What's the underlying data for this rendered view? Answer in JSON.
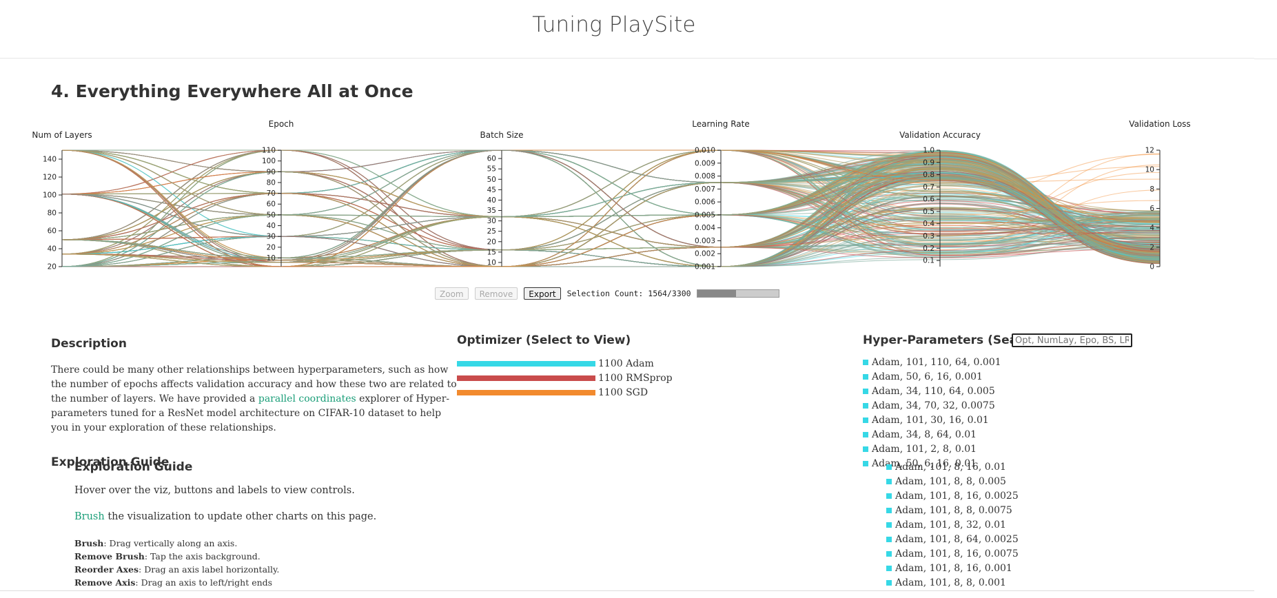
{
  "site_title": "Tuning PlaySite",
  "section_heading": "4. Everything Everywhere All at Once",
  "parallel_coords": {
    "axes": [
      {
        "label": "Num of Layers",
        "ticks": [
          "20",
          "40",
          "60",
          "80",
          "100",
          "120",
          "140"
        ],
        "domain": [
          20,
          150
        ]
      },
      {
        "label": "Epoch",
        "ticks": [
          "10",
          "20",
          "30",
          "40",
          "50",
          "60",
          "70",
          "80",
          "90",
          "100",
          "110"
        ],
        "domain": [
          2,
          110
        ]
      },
      {
        "label": "Batch Size",
        "ticks": [
          "10",
          "15",
          "20",
          "25",
          "30",
          "35",
          "40",
          "45",
          "50",
          "55",
          "60"
        ],
        "domain": [
          8,
          64
        ]
      },
      {
        "label": "Learning Rate",
        "ticks": [
          "0.001",
          "0.002",
          "0.003",
          "0.004",
          "0.005",
          "0.006",
          "0.007",
          "0.008",
          "0.009",
          "0.010"
        ],
        "domain": [
          0.001,
          0.01
        ]
      },
      {
        "label": "Validation Accuracy",
        "ticks": [
          "0.1",
          "0.2",
          "0.3",
          "0.4",
          "0.5",
          "0.6",
          "0.7",
          "0.8",
          "0.9",
          "1.0"
        ],
        "domain": [
          0.05,
          1.0
        ]
      },
      {
        "label": "Validation Loss",
        "ticks": [
          "0",
          "2",
          "4",
          "6",
          "8",
          "10",
          "12"
        ],
        "domain": [
          0,
          12
        ]
      }
    ],
    "colors": {
      "adam": "#36d8e6",
      "rmsprop": "#c94c4c",
      "sgd": "#f28a2e",
      "neutral": "#7aa89a",
      "tan": "#b59a5a"
    }
  },
  "controls": {
    "zoom_label": "Zoom",
    "remove_label": "Remove",
    "export_label": "Export",
    "selection_count_text": "Selection Count: 1564/3300",
    "selection_fraction": 0.474
  },
  "description": {
    "heading": "Description",
    "text_before_link": "There could be many other relationships between hyperparameters, such as how the number of epochs affects validation accuracy and how these two are related to the number of layers. We have provided a ",
    "link_text": "parallel coordinates",
    "text_after_link": " explorer of Hyper-parameters tuned for a ResNet model architecture on CIFAR-10 dataset to help you in your exploration of these relationships."
  },
  "guide": {
    "heading": "Exploration Guide",
    "hover_text": "Hover over the viz, buttons and labels to view controls.",
    "brush_link": "Brush",
    "brush_rest": " the visualization to update other charts on this page.",
    "items": [
      {
        "term": "Brush",
        "text": ": Drag vertically along an axis."
      },
      {
        "term": "Remove Brush",
        "text": ": Tap the axis background."
      },
      {
        "term": "Reorder Axes",
        "text": ": Drag an axis label horizontally."
      },
      {
        "term": "Remove Axis",
        "text": ": Drag an axis to left/right ends"
      }
    ]
  },
  "optimizer": {
    "heading": "Optimizer (Select to View)",
    "items": [
      {
        "label": "1100 Adam",
        "color": "#36d8e6"
      },
      {
        "label": "1100 RMSprop",
        "color": "#c94c4c"
      },
      {
        "label": "1100 SGD",
        "color": "#f28a2e"
      }
    ]
  },
  "hyperparams": {
    "heading": "Hyper-Parameters (Search)",
    "placeholder": "Opt, NumLay, Epo, BS, LR",
    "list_a": [
      "Adam, 101, 110, 64, 0.001",
      "Adam, 50, 6, 16, 0.001",
      "Adam, 34, 110, 64, 0.005",
      "Adam, 34, 70, 32, 0.0075",
      "Adam, 101, 30, 16, 0.01",
      "Adam, 34, 8, 64, 0.01",
      "Adam, 101, 2, 8, 0.01",
      "Adam, 50, 6, 16, 0.01"
    ],
    "list_b": [
      "Adam, 101, 8, 16, 0.01",
      "Adam, 101, 8, 8, 0.005",
      "Adam, 101, 8, 16, 0.0025",
      "Adam, 101, 8, 8, 0.0075",
      "Adam, 101, 8, 32, 0.01",
      "Adam, 101, 8, 64, 0.0025",
      "Adam, 101, 8, 16, 0.0075",
      "Adam, 101, 8, 16, 0.001",
      "Adam, 101, 8, 8, 0.001"
    ]
  }
}
